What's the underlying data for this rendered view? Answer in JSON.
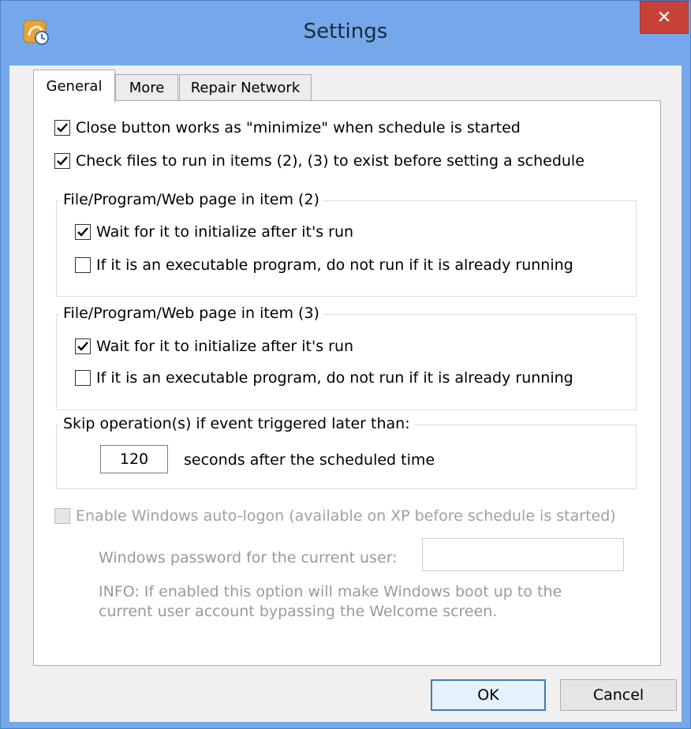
{
  "window": {
    "title": "Settings",
    "close_symbol": "✕"
  },
  "tabs": [
    {
      "label": "General",
      "active": true
    },
    {
      "label": "More",
      "active": false
    },
    {
      "label": "Repair Network",
      "active": false
    }
  ],
  "general": {
    "close_minimize": {
      "label": "Close button works as \"minimize\" when schedule is started",
      "checked": true
    },
    "check_files": {
      "label": "Check files to run in items (2), (3) to exist before setting a schedule",
      "checked": true
    },
    "group2": {
      "title": "File/Program/Web page in item (2)",
      "wait_init": {
        "label": "Wait for it to initialize after it's run",
        "checked": true
      },
      "no_rerun": {
        "label": "If it is an executable program, do not run if it is already running",
        "checked": false
      }
    },
    "group3": {
      "title": "File/Program/Web page in item (3)",
      "wait_init": {
        "label": "Wait for it to initialize after it's run",
        "checked": true
      },
      "no_rerun": {
        "label": "If it is an executable program, do not run if it is already running",
        "checked": false
      }
    },
    "skip": {
      "title": "Skip operation(s) if event triggered later than:",
      "value": "120",
      "suffix": "seconds after the scheduled time"
    },
    "autologon": {
      "label": "Enable Windows auto-logon (available on XP before schedule is started)",
      "checked": false,
      "enabled": false,
      "password_label": "Windows password for the current user:",
      "password_value": "",
      "info_line1": "INFO: If enabled this option will make Windows boot up to the",
      "info_line2": "current user account bypassing the Welcome screen."
    }
  },
  "buttons": {
    "ok": "OK",
    "cancel": "Cancel"
  },
  "icons": {
    "app": "scheduler-clock-icon",
    "close": "close-icon",
    "check": "checkmark-icon"
  },
  "colors": {
    "titlebar": "#75a8ea",
    "close_button": "#c7433a",
    "client_bg": "#f0f0f0",
    "panel_bg": "#ffffff",
    "disabled_text": "#9a9a9a"
  }
}
